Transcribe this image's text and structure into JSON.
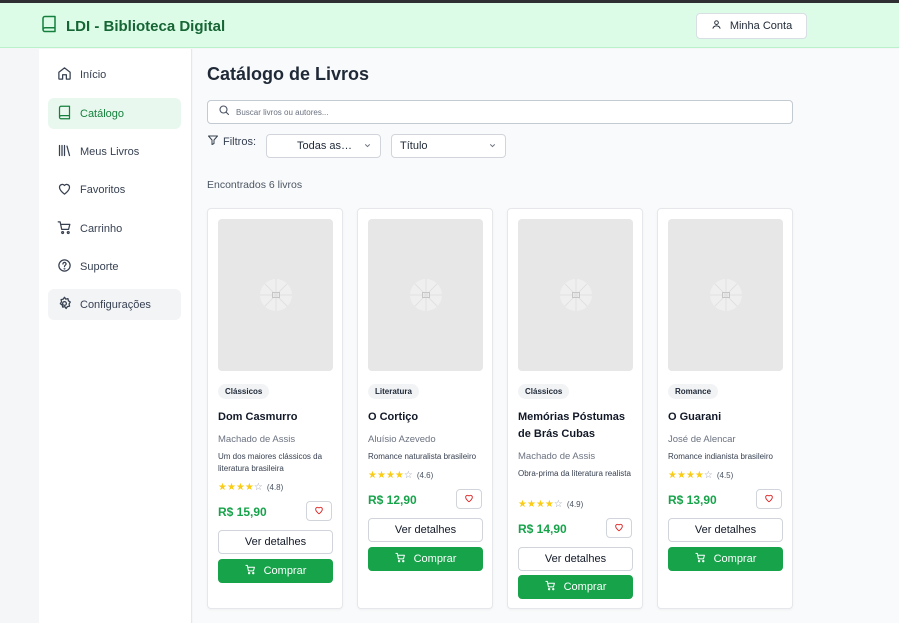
{
  "header": {
    "title": "LDI - Biblioteca Digital",
    "account_label": "Minha Conta"
  },
  "sidebar": {
    "items": [
      {
        "label": "Início",
        "icon": "home-icon"
      },
      {
        "label": "Catálogo",
        "icon": "book-icon"
      },
      {
        "label": "Meus Livros",
        "icon": "library-icon"
      },
      {
        "label": "Favoritos",
        "icon": "heart-icon"
      },
      {
        "label": "Carrinho",
        "icon": "cart-icon"
      },
      {
        "label": "Suporte",
        "icon": "help-circle-icon"
      },
      {
        "label": "Configurações",
        "icon": "gear-icon"
      }
    ]
  },
  "main": {
    "title": "Catálogo de Livros",
    "search_placeholder": "Buscar livros ou autores...",
    "filters_label": "Filtros:",
    "category_select": "Todas as…",
    "sort_select": "Título",
    "found_text": "Encontrados 6 livros"
  },
  "books": [
    {
      "category": "Clássicos",
      "title": "Dom Casmurro",
      "author": "Machado de Assis",
      "description": "Um dos maiores clássicos da literatura brasileira",
      "rating": 4.8,
      "rating_label": "(4.8)",
      "price": "R$ 15,90",
      "details_label": "Ver detalhes",
      "buy_label": "Comprar"
    },
    {
      "category": "Literatura",
      "title": "O Cortiço",
      "author": "Aluísio Azevedo",
      "description": "Romance naturalista brasileiro",
      "rating": 4.6,
      "rating_label": "(4.6)",
      "price": "R$ 12,90",
      "details_label": "Ver detalhes",
      "buy_label": "Comprar"
    },
    {
      "category": "Clássicos",
      "title": "Memórias Póstumas de Brás Cubas",
      "author": "Machado de Assis",
      "description": "Obra-prima da literatura realista",
      "rating": 4.9,
      "rating_label": "(4.9)",
      "price": "R$ 14,90",
      "details_label": "Ver detalhes",
      "buy_label": "Comprar"
    },
    {
      "category": "Romance",
      "title": "O Guarani",
      "author": "José de Alencar",
      "description": "Romance indianista brasileiro",
      "rating": 4.5,
      "rating_label": "(4.5)",
      "price": "R$ 13,90",
      "details_label": "Ver detalhes",
      "buy_label": "Comprar"
    }
  ],
  "colors": {
    "accent": "#16a34a",
    "header_bg": "#dcfce7",
    "brand_text": "#166534",
    "star": "#facc15",
    "heart": "#dc2626"
  }
}
